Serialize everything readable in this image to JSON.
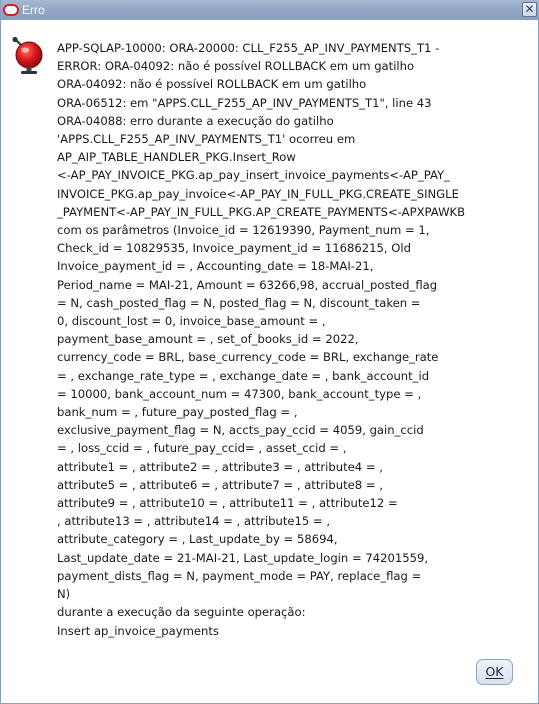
{
  "window": {
    "title": "Erro"
  },
  "icons": {
    "app": "oracle-icon",
    "close": "close-icon",
    "alert": "error-bell-icon"
  },
  "colors": {
    "titlebar": "#92a7c5",
    "icon_red": "#d0202a",
    "button_border": "#8ea3c2"
  },
  "message_lines": [
    "APP-SQLAP-10000: ORA-20000: CLL_F255_AP_INV_PAYMENTS_T1 -",
    "ERROR: ORA-04092: não é possível ROLLBACK em um gatilho",
    "ORA-04092: não é possível ROLLBACK em um gatilho",
    "ORA-06512: em \"APPS.CLL_F255_AP_INV_PAYMENTS_T1\", line 43",
    "ORA-04088: erro durante a execução do gatilho",
    "'APPS.CLL_F255_AP_INV_PAYMENTS_T1' ocorreu em",
    "AP_AIP_TABLE_HANDLER_PKG.Insert_Row",
    "<-AP_PAY_INVOICE_PKG.ap_pay_insert_invoice_payments<-AP_PAY_",
    "INVOICE_PKG.ap_pay_invoice<-AP_PAY_IN_FULL_PKG.CREATE_SINGLE",
    "_PAYMENT<-AP_PAY_IN_FULL_PKG.AP_CREATE_PAYMENTS<-APXPAWKB",
    "com os parâmetros (Invoice_id = 12619390, Payment_num = 1,",
    "Check_id = 10829535, Invoice_payment_id = 11686215, Old",
    "Invoice_payment_id = , Accounting_date = 18-MAI-21,",
    "Period_name = MAI-21, Amount = 63266,98, accrual_posted_flag",
    "= N, cash_posted_flag = N, posted_flag = N, discount_taken =",
    "0, discount_lost = 0, invoice_base_amount = ,",
    "payment_base_amount = , set_of_books_id = 2022,",
    "currency_code = BRL, base_currency_code = BRL, exchange_rate",
    "= , exchange_rate_type = , exchange_date = , bank_account_id",
    "= 10000, bank_account_num = 47300, bank_account_type = ,",
    "bank_num = , future_pay_posted_flag = ,",
    "exclusive_payment_flag = N, accts_pay_ccid = 4059, gain_ccid",
    "= , loss_ccid = , future_pay_ccid= , asset_ccid = ,",
    "attribute1 = , attribute2 = , attribute3 = , attribute4 = ,",
    "attribute5 = , attribute6 = , attribute7 = , attribute8 = ,",
    "attribute9 = , attribute10 = , attribute11 = , attribute12 =",
    ", attribute13 = , attribute14 = , attribute15 = ,",
    "attribute_category = , Last_update_by = 58694,",
    "Last_update_date = 21-MAI-21, Last_update_login = 74201559,",
    "payment_dists_flag = N, payment_mode = PAY, replace_flag =",
    "N)",
    "durante a execução da seguinte operação:",
    "Insert ap_invoice_payments"
  ],
  "buttons": {
    "ok_label": "OK"
  }
}
